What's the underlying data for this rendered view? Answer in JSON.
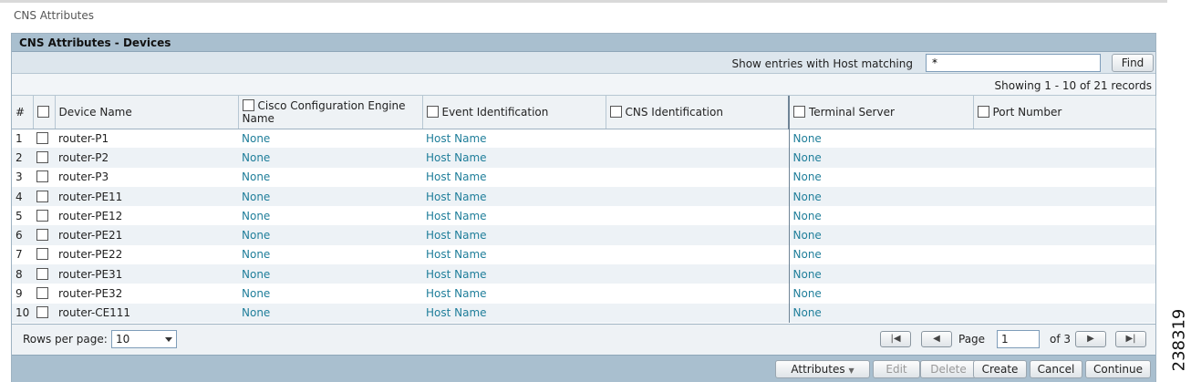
{
  "page": {
    "title": "CNS Attributes"
  },
  "panel": {
    "title": "CNS Attributes - Devices"
  },
  "filter": {
    "label": "Show entries with Host matching",
    "value": "*",
    "find_label": "Find"
  },
  "records": {
    "summary": "Showing 1 - 10 of 21 records"
  },
  "table": {
    "headers": {
      "index": "#",
      "device_name": "Device Name",
      "engine_name": "Cisco Configuration Engine Name",
      "event_id": "Event Identification",
      "cns_id": "CNS Identification",
      "terminal_server": "Terminal Server",
      "port_number": "Port Number"
    },
    "rows": [
      {
        "n": "1",
        "device": "router-P1",
        "engine": "None",
        "event": "Host Name",
        "cns": "",
        "terminal": "None",
        "port": ""
      },
      {
        "n": "2",
        "device": "router-P2",
        "engine": "None",
        "event": "Host Name",
        "cns": "",
        "terminal": "None",
        "port": ""
      },
      {
        "n": "3",
        "device": "router-P3",
        "engine": "None",
        "event": "Host Name",
        "cns": "",
        "terminal": "None",
        "port": ""
      },
      {
        "n": "4",
        "device": "router-PE11",
        "engine": "None",
        "event": "Host Name",
        "cns": "",
        "terminal": "None",
        "port": ""
      },
      {
        "n": "5",
        "device": "router-PE12",
        "engine": "None",
        "event": "Host Name",
        "cns": "",
        "terminal": "None",
        "port": ""
      },
      {
        "n": "6",
        "device": "router-PE21",
        "engine": "None",
        "event": "Host Name",
        "cns": "",
        "terminal": "None",
        "port": ""
      },
      {
        "n": "7",
        "device": "router-PE22",
        "engine": "None",
        "event": "Host Name",
        "cns": "",
        "terminal": "None",
        "port": ""
      },
      {
        "n": "8",
        "device": "router-PE31",
        "engine": "None",
        "event": "Host Name",
        "cns": "",
        "terminal": "None",
        "port": ""
      },
      {
        "n": "9",
        "device": "router-PE32",
        "engine": "None",
        "event": "Host Name",
        "cns": "",
        "terminal": "None",
        "port": ""
      },
      {
        "n": "10",
        "device": "router-CE111",
        "engine": "None",
        "event": "Host Name",
        "cns": "",
        "terminal": "None",
        "port": ""
      }
    ]
  },
  "pager": {
    "rows_label": "Rows per page:",
    "rows_value": "10",
    "page_label": "Page",
    "page_value": "1",
    "of_label": "of 3"
  },
  "actions": {
    "attributes": "Attributes",
    "edit": "Edit",
    "delete": "Delete",
    "create": "Create",
    "cancel": "Cancel",
    "continue": "Continue"
  },
  "side_number": "238319",
  "colors": {
    "header_bg": "#a9bfcf",
    "link": "#1f7e9a",
    "alt_row": "#edf2f6"
  }
}
